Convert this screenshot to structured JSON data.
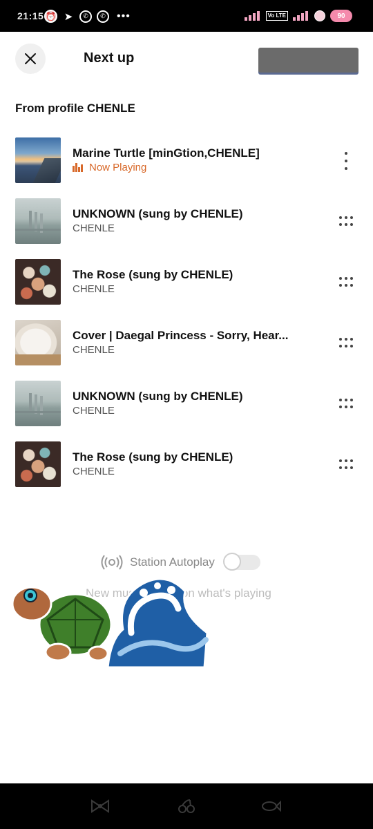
{
  "status_bar": {
    "time": "21:15",
    "volte": "Vo LTE",
    "battery": "90"
  },
  "header": {
    "title": "Next up"
  },
  "section": {
    "title": "From profile CHENLE"
  },
  "queue": [
    {
      "title": "Marine Turtle [minGtion,CHENLE]",
      "subtitle": "Now Playing",
      "now_playing": true,
      "thumb": "sunset-pier"
    },
    {
      "title": "UNKNOWN (sung by CHENLE)",
      "subtitle": "CHENLE",
      "now_playing": false,
      "thumb": "bridge"
    },
    {
      "title": "The Rose (sung by CHENLE)",
      "subtitle": "CHENLE",
      "now_playing": false,
      "thumb": "plush-toys"
    },
    {
      "title": "Cover | Daegal Princess - Sorry, Hear...",
      "subtitle": "CHENLE",
      "now_playing": false,
      "thumb": "sleeping-dog"
    },
    {
      "title": "UNKNOWN (sung by CHENLE)",
      "subtitle": "CHENLE",
      "now_playing": false,
      "thumb": "bridge"
    },
    {
      "title": "The Rose (sung by CHENLE)",
      "subtitle": "CHENLE",
      "now_playing": false,
      "thumb": "plush-toys"
    }
  ],
  "autoplay": {
    "label": "Station Autoplay",
    "description": "New music based on what's playing",
    "enabled": false
  },
  "colors": {
    "accent": "#d8692a",
    "text": "#111111",
    "muted": "#888888"
  },
  "icons": [
    "close-icon",
    "station-icon",
    "more-vertical-icon",
    "more-horizontal-icon",
    "equalizer-icon"
  ]
}
